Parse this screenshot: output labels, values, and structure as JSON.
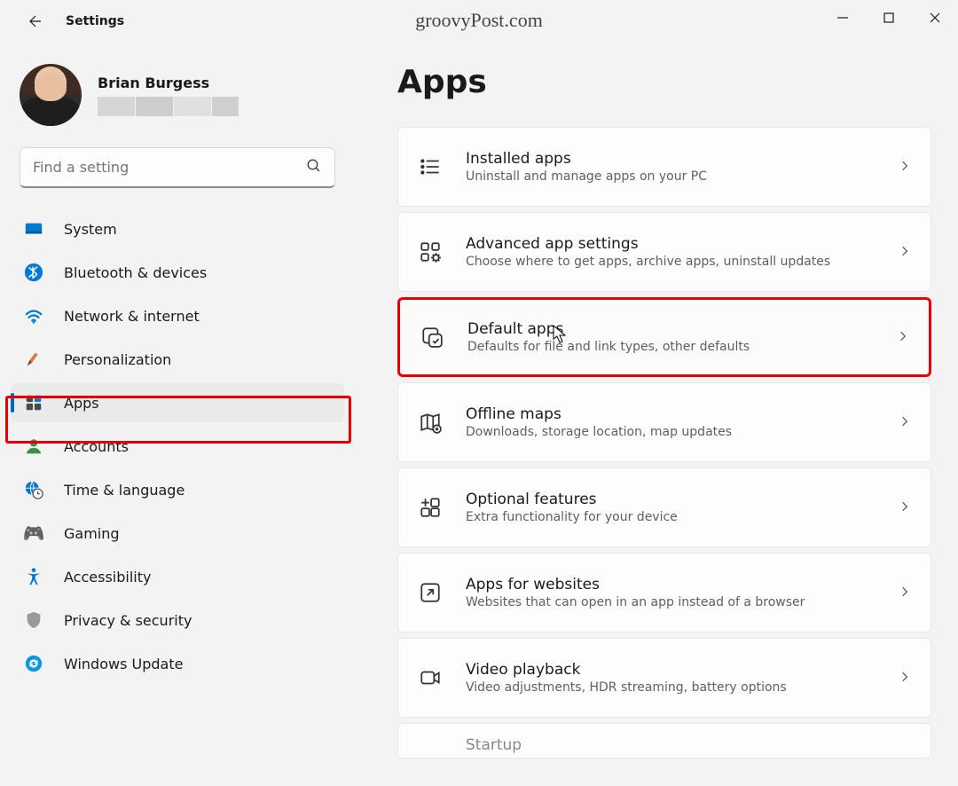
{
  "window": {
    "app_title": "Settings",
    "watermark": "groovyPost.com"
  },
  "profile": {
    "name": "Brian Burgess"
  },
  "search": {
    "placeholder": "Find a setting"
  },
  "sidebar": {
    "items": [
      {
        "label": "System"
      },
      {
        "label": "Bluetooth & devices"
      },
      {
        "label": "Network & internet"
      },
      {
        "label": "Personalization"
      },
      {
        "label": "Apps"
      },
      {
        "label": "Accounts"
      },
      {
        "label": "Time & language"
      },
      {
        "label": "Gaming"
      },
      {
        "label": "Accessibility"
      },
      {
        "label": "Privacy & security"
      },
      {
        "label": "Windows Update"
      }
    ],
    "selected_index": 4
  },
  "page": {
    "title": "Apps",
    "cards": [
      {
        "title": "Installed apps",
        "desc": "Uninstall and manage apps on your PC"
      },
      {
        "title": "Advanced app settings",
        "desc": "Choose where to get apps, archive apps, uninstall updates"
      },
      {
        "title": "Default apps",
        "desc": "Defaults for file and link types, other defaults"
      },
      {
        "title": "Offline maps",
        "desc": "Downloads, storage location, map updates"
      },
      {
        "title": "Optional features",
        "desc": "Extra functionality for your device"
      },
      {
        "title": "Apps for websites",
        "desc": "Websites that can open in an app instead of a browser"
      },
      {
        "title": "Video playback",
        "desc": "Video adjustments, HDR streaming, battery options"
      },
      {
        "title": "Startup",
        "desc": ""
      }
    ],
    "highlight_index": 2
  },
  "colors": {
    "accent": "#0067c0",
    "highlight_border": "#e80000"
  }
}
